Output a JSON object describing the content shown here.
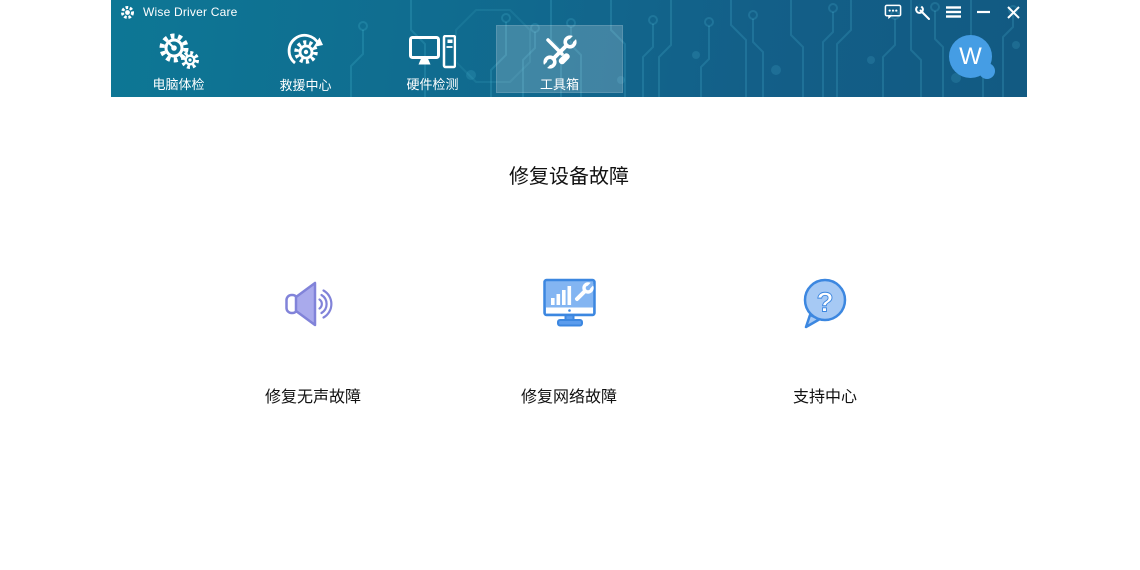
{
  "app": {
    "title": "Wise Driver Care"
  },
  "titlebar": {
    "icons": [
      "feedback-icon",
      "settings-wrench-icon",
      "menu-icon",
      "minimize-icon",
      "close-icon"
    ]
  },
  "nav": {
    "tabs": [
      {
        "label": "电脑体检",
        "icon": "pc-checkup-gears-icon",
        "active": false
      },
      {
        "label": "救援中心",
        "icon": "rescue-center-icon",
        "active": false
      },
      {
        "label": "硬件检测",
        "icon": "hardware-detect-icon",
        "active": false
      },
      {
        "label": "工具箱",
        "icon": "toolbox-icon",
        "active": true
      }
    ]
  },
  "user": {
    "avatar_initial": "W"
  },
  "main": {
    "section_title": "修复设备故障",
    "tools": [
      {
        "label": "修复无声故障",
        "icon": "speaker-fix-icon"
      },
      {
        "label": "修复网络故障",
        "icon": "network-fix-icon"
      },
      {
        "label": "支持中心",
        "icon": "support-center-icon",
        "glyph": "?"
      }
    ]
  },
  "colors": {
    "header_teal": "#0d7795",
    "header_blue": "#125a82",
    "accent_blue": "#3c87e0",
    "icon_purple": "#8183d9",
    "avatar_blue": "#459de4",
    "active_tab_overlay": "rgba(255,255,255,0.20)"
  }
}
